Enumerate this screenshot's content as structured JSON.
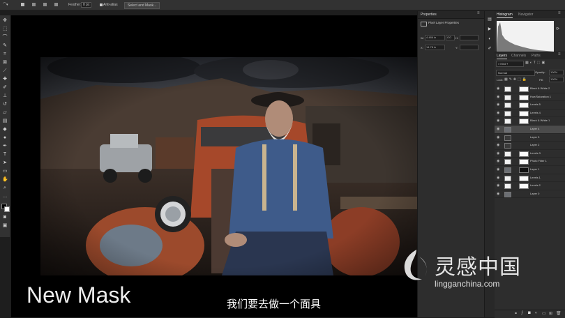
{
  "options_bar": {
    "feather_label": "Feather:",
    "feather_value": "0 px",
    "antialias_label": "Anti-alias",
    "select_mask_button": "Select and Mask..."
  },
  "properties": {
    "tab": "Properties",
    "section": "Pixel Layer Properties",
    "w_label": "W:",
    "w_value": "4.486 in",
    "go_label": "GO",
    "h_label": "H:",
    "x_label": "X:",
    "x_value": "14.78 in",
    "y_label": "Y:"
  },
  "histogram_tabs": [
    "Histogram",
    "Navigator"
  ],
  "layers_tabs": [
    "Layers",
    "Channels",
    "Paths"
  ],
  "layers_controls": {
    "filter_kind": "Kind",
    "blend_mode": "Normal",
    "opacity_label": "Opacity:",
    "opacity_value": "100%",
    "lock_label": "Lock:",
    "fill_label": "Fill:",
    "fill_value": "100%"
  },
  "layers": [
    {
      "name": "Black & White 2",
      "thumb": "adj",
      "mask": "white",
      "selected": false
    },
    {
      "name": "Hue/Saturation 1",
      "thumb": "adj",
      "mask": "white",
      "selected": false
    },
    {
      "name": "Levels 5",
      "thumb": "adj",
      "mask": "white",
      "selected": false
    },
    {
      "name": "Levels 4",
      "thumb": "adj",
      "mask": "white",
      "selected": false
    },
    {
      "name": "Black & White 1",
      "thumb": "adj",
      "mask": "white",
      "selected": false
    },
    {
      "name": "Layer 4",
      "thumb": "img",
      "mask": "",
      "selected": true
    },
    {
      "name": "Layer 3",
      "thumb": "dark",
      "mask": "",
      "selected": false
    },
    {
      "name": "Layer 2",
      "thumb": "dark",
      "mask": "",
      "selected": false
    },
    {
      "name": "Levels 3",
      "thumb": "adj",
      "mask": "white",
      "selected": false
    },
    {
      "name": "Photo Filter 1",
      "thumb": "adj",
      "mask": "white",
      "selected": false
    },
    {
      "name": "Layer 1",
      "thumb": "img",
      "mask": "dark",
      "selected": false
    },
    {
      "name": "Levels 1",
      "thumb": "adj",
      "mask": "white",
      "selected": false
    },
    {
      "name": "Levels 2",
      "thumb": "adj",
      "mask": "white",
      "selected": false
    },
    {
      "name": "Layer 0",
      "thumb": "img",
      "mask": "",
      "selected": false
    }
  ],
  "caption_en": "New Mask",
  "caption_cn": "我们要去做一个面具",
  "watermark": {
    "cn": "灵感中国",
    "url": "lingganchina.com"
  },
  "colors": {
    "ui_dark": "#1e1e1e",
    "panel": "#2d2d2d",
    "selection": "#4b4b4b"
  }
}
